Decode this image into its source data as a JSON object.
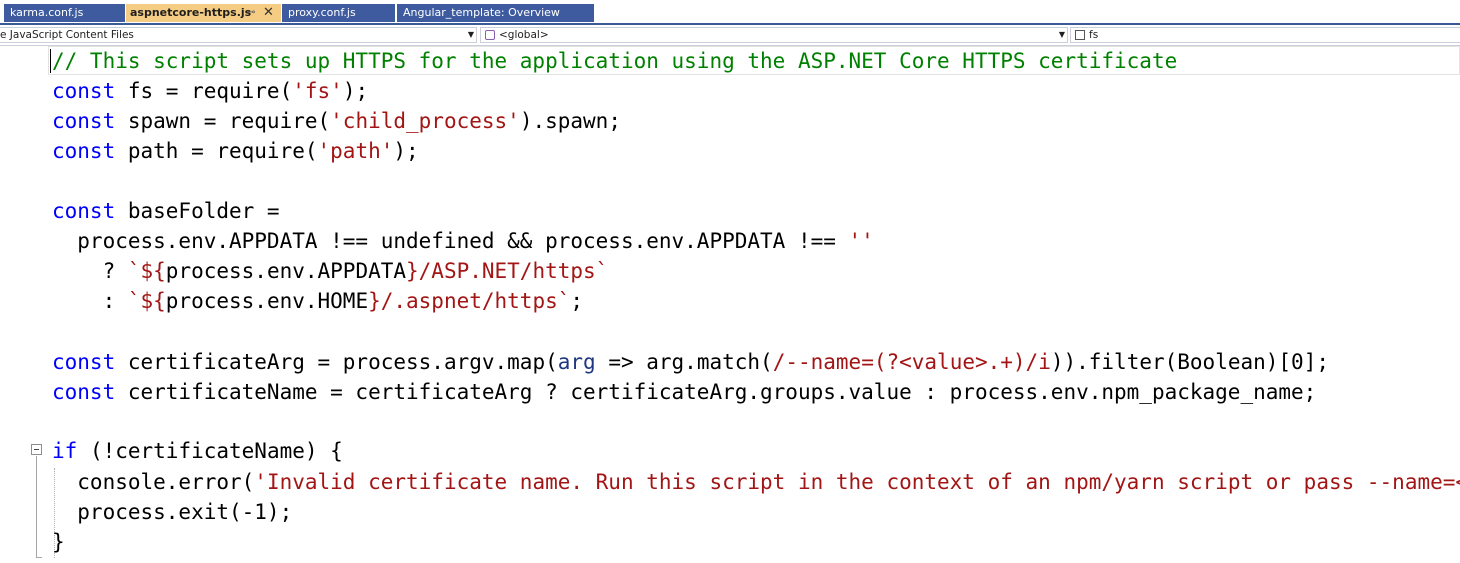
{
  "tabs": [
    {
      "label": "karma.conf.js",
      "active": false
    },
    {
      "label": "aspnetcore-https.js",
      "active": true
    },
    {
      "label": "proxy.conf.js",
      "active": false
    },
    {
      "label": "Angular_template: Overview",
      "active": false
    }
  ],
  "navbar": {
    "project": "e JavaScript Content Files",
    "scope": "<global>",
    "member": "fs"
  },
  "code": {
    "line1": "// This script sets up HTTPS for the application using the ASP.NET Core HTTPS certificate",
    "line2": [
      "const",
      " fs = require(",
      "'fs'",
      ");"
    ],
    "line3": [
      "const",
      " spawn = require(",
      "'child_process'",
      ").spawn;"
    ],
    "line4": [
      "const",
      " path = require(",
      "'path'",
      ");"
    ],
    "line6": [
      "const",
      " baseFolder ="
    ],
    "line7": [
      "  process.env.APPDATA !== undefined && process.env.APPDATA !== ",
      "''"
    ],
    "line8": [
      "    ? ",
      "`${",
      "process.env.APPDATA",
      "}/ASP.NET/https`"
    ],
    "line9": [
      "    : ",
      "`${",
      "process.env.HOME",
      "}/.aspnet/https`",
      ";"
    ],
    "line11": [
      "const",
      " certificateArg = process.argv.map(",
      "arg",
      " => arg.match(",
      "/--name=(?<value>.+)/i",
      ")).filter(Boolean)[0];"
    ],
    "line12": [
      "const",
      " certificateName = certificateArg ? certificateArg.groups.value : process.env.npm_package_name;"
    ],
    "line14": [
      "if",
      " (!certificateName) {"
    ],
    "line15": [
      "  console.error(",
      "'Invalid certificate name. Run this script in the context of an npm/yarn script or pass --name=<"
    ],
    "line16": "  process.exit(-1);",
    "line17": "}"
  },
  "colors": {
    "keyword": "#0000ff",
    "string": "#a31515",
    "comment": "#008000",
    "tab_active": "#f5cc84",
    "tab_inactive": "#3e5ba0"
  }
}
